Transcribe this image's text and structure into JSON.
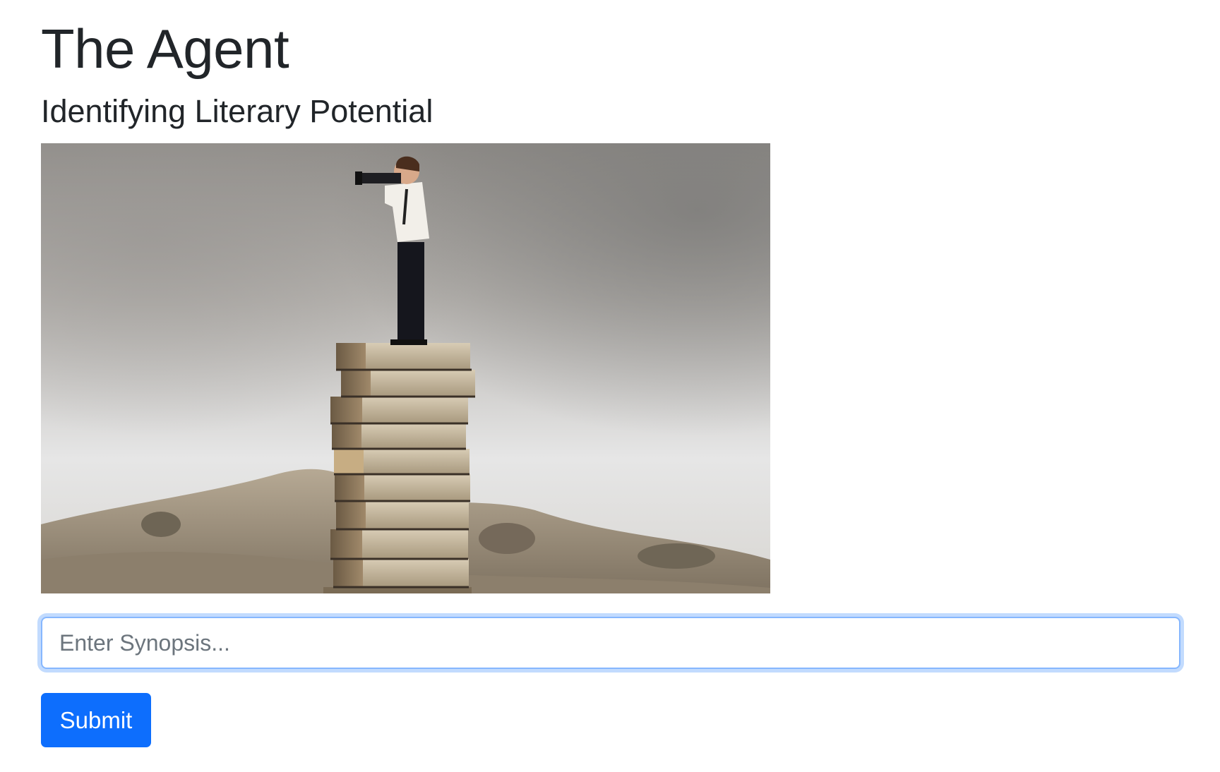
{
  "header": {
    "title": "The Agent",
    "subtitle": "Identifying Literary Potential"
  },
  "hero_image": {
    "subject": "man-with-spyglass-on-book-stack"
  },
  "form": {
    "synopsis_placeholder": "Enter Synopsis...",
    "synopsis_value": "",
    "submit_label": "Submit"
  },
  "colors": {
    "primary": "#0d6efd",
    "focus_border": "#86b7fe",
    "text": "#212529",
    "placeholder": "#6c757d"
  }
}
